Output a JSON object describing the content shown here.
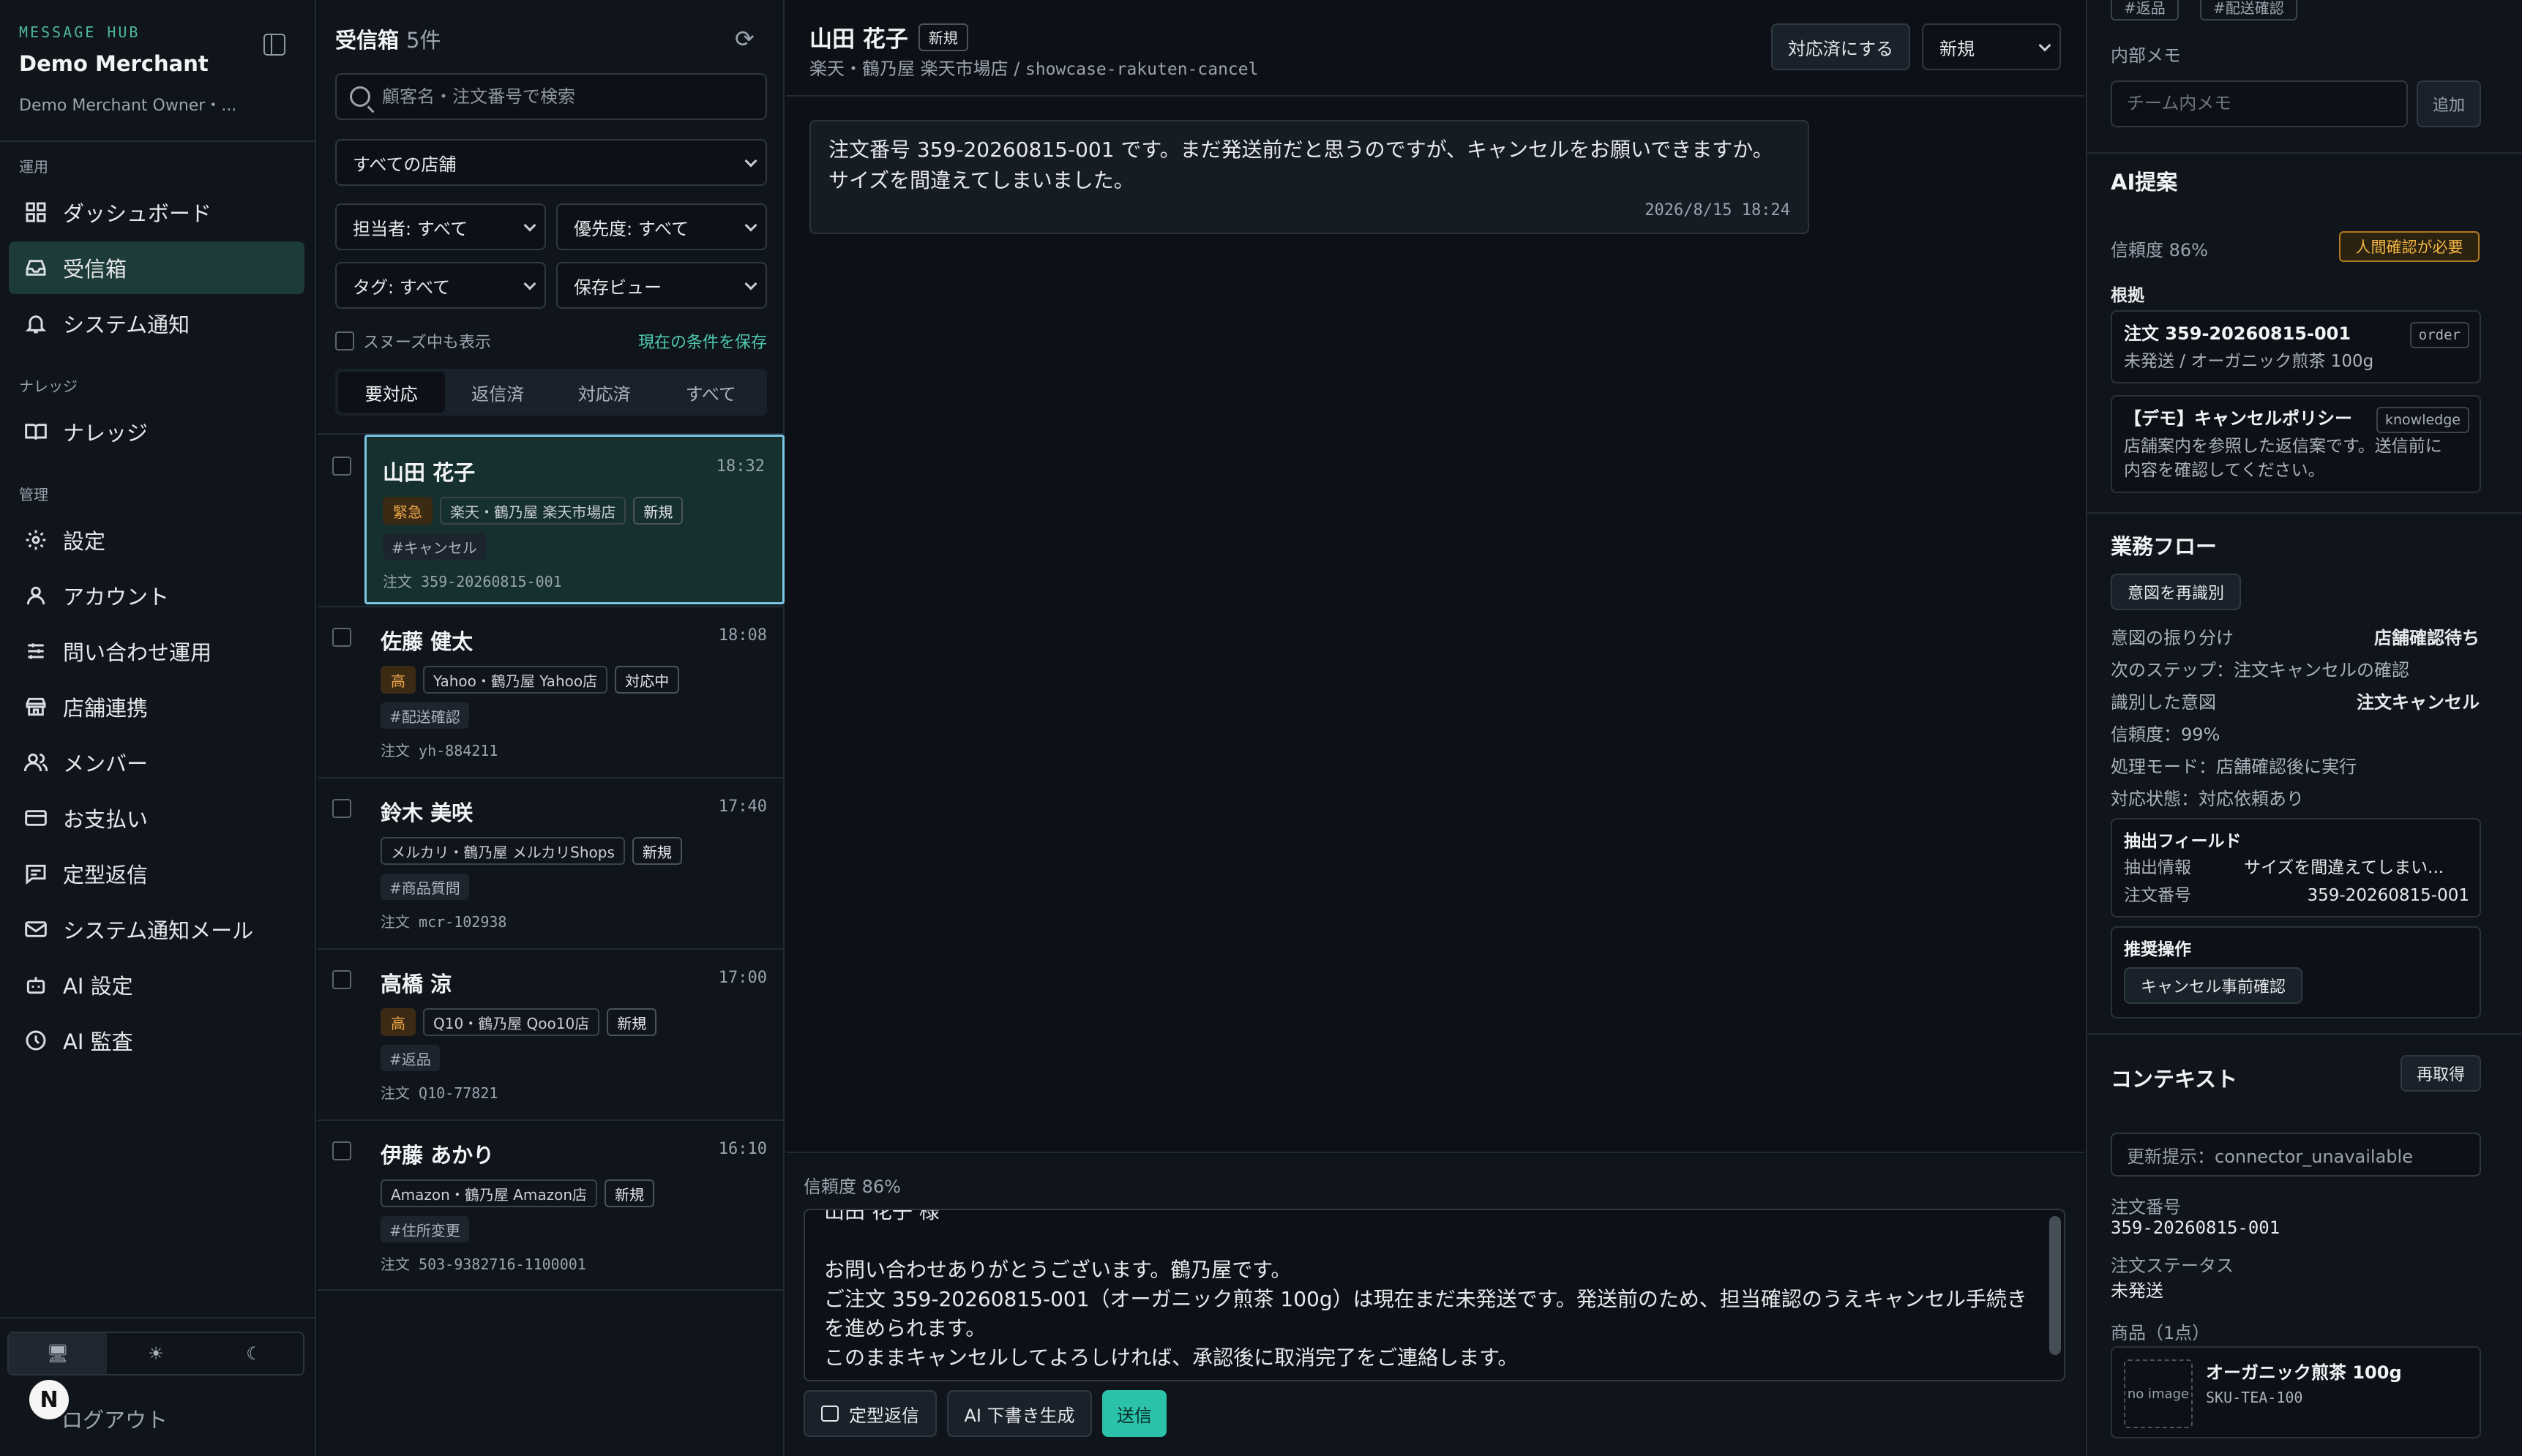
{
  "sidebar": {
    "kicker": "MESSAGE HUB",
    "merchant": "Demo Merchant",
    "owner": "Demo Merchant Owner・...",
    "sections": {
      "ops": "運用",
      "knowledge": "ナレッジ",
      "admin": "管理"
    },
    "items": [
      {
        "label": "ダッシュボード",
        "icon": "dashboard-icon"
      },
      {
        "label": "受信箱",
        "icon": "inbox-icon"
      },
      {
        "label": "システム通知",
        "icon": "bell-icon"
      },
      {
        "label": "ナレッジ",
        "icon": "book-icon"
      },
      {
        "label": "設定",
        "icon": "gear-icon"
      },
      {
        "label": "アカウント",
        "icon": "user-icon"
      },
      {
        "label": "問い合わせ運用",
        "icon": "sliders-icon"
      },
      {
        "label": "店舗連携",
        "icon": "store-icon"
      },
      {
        "label": "メンバー",
        "icon": "users-icon"
      },
      {
        "label": "お支払い",
        "icon": "credit-card-icon"
      },
      {
        "label": "定型返信",
        "icon": "message-icon"
      },
      {
        "label": "システム通知メール",
        "icon": "mail-icon"
      },
      {
        "label": "AI 設定",
        "icon": "bot-icon"
      },
      {
        "label": "AI 監査",
        "icon": "audit-icon"
      }
    ],
    "avatar": "N",
    "logout": "ログアウト"
  },
  "inbox": {
    "title": "受信箱",
    "count": "5件",
    "search_placeholder": "顧客名・注文番号で検索",
    "store_filter": "すべての店舗",
    "assignee_filter": "担当者: すべて",
    "priority_filter": "優先度: すべて",
    "tag_filter": "タグ: すべて",
    "saved_view": "保存ビュー",
    "snooze_label": "スヌーズ中も表示",
    "save_condition": "現在の条件を保存",
    "tabs": [
      "要対応",
      "返信済",
      "対応済",
      "すべて"
    ],
    "conversations": [
      {
        "name": "山田 花子",
        "time": "18:32",
        "priority": "緊急",
        "store": "楽天・鶴乃屋 楽天市場店",
        "status": "新規",
        "tag": "#キャンセル",
        "order": "注文 359-20260815-001"
      },
      {
        "name": "佐藤 健太",
        "time": "18:08",
        "priority": "高",
        "store": "Yahoo・鶴乃屋 Yahoo店",
        "status": "対応中",
        "tag": "#配送確認",
        "order": "注文 yh-884211"
      },
      {
        "name": "鈴木 美咲",
        "time": "17:40",
        "priority": "",
        "store": "メルカリ・鶴乃屋 メルカリShops",
        "status": "新規",
        "tag": "#商品質問",
        "order": "注文 mcr-102938"
      },
      {
        "name": "高橋 涼",
        "time": "17:00",
        "priority": "高",
        "store": "Q10・鶴乃屋 Qoo10店",
        "status": "新規",
        "tag": "#返品",
        "order": "注文 Q10-77821"
      },
      {
        "name": "伊藤 あかり",
        "time": "16:10",
        "priority": "",
        "store": "Amazon・鶴乃屋 Amazon店",
        "status": "新規",
        "tag": "#住所変更",
        "order": "注文 503-9382716-1100001"
      }
    ]
  },
  "conversation": {
    "customer": "山田 花子",
    "status_badge": "新規",
    "store_path": "楽天・鶴乃屋 楽天市場店 / ",
    "slug": "showcase-rakuten-cancel",
    "resolve_button": "対応済にする",
    "status_select": "新規",
    "message": "注文番号 359-20260815-001 です。まだ発送前だと思うのですが、キャンセルをお願いできますか。\nサイズを間違えてしまいました。",
    "message_time": "2026/8/15 18:24",
    "confidence": "信頼度 86%",
    "draft": "山田 花子 様\n\nお問い合わせありがとうございます。鶴乃屋です。\nご注文 359-20260815-001（オーガニック煎茶 100g）は現在まだ未発送です。発送前のため、担当確認のうえキャンセル手続きを進められます。\nこのままキャンセルしてよろしければ、承認後に取消完了をご連絡します。",
    "template_button": "定型返信",
    "ai_draft_button": "AI 下書き生成",
    "send_button": "送信"
  },
  "panel": {
    "tags": [
      "#返品",
      "#配送確認"
    ],
    "memo_label": "内部メモ",
    "memo_placeholder": "チーム内メモ",
    "memo_add": "追加",
    "ai_title": "AI提案",
    "ai_confidence": "信頼度 86%",
    "human_check": "人間確認が必要",
    "evidence_label": "根拠",
    "evidence": [
      {
        "title": "注文 359-20260815-001",
        "kind": "order",
        "body": "未発送 / オーガニック煎茶 100g"
      },
      {
        "title": "【デモ】キャンセルポリシー",
        "kind": "knowledge",
        "body": "店舗案内を参照した返信案です。送信前に\n内容を確認してください。"
      }
    ],
    "flow_title": "業務フロー",
    "reidentify": "意図を再識別",
    "intent_routing_label": "意図の振り分け",
    "intent_routing_value": "店舗確認待ち",
    "next_step": "次のステップ：注文キャンセルの確認",
    "identified_label": "識別した意図",
    "identified_value": "注文キャンセル",
    "flow_confidence": "信頼度：99%",
    "mode": "処理モード：店舗確認後に実行",
    "handling": "対応状態：対応依頼あり",
    "extracted_title": "抽出フィールド",
    "extracted_info_label": "抽出情報",
    "extracted_info_value": "サイズを間違えてしまい...",
    "order_no_label": "注文番号",
    "order_no_value": "359-20260815-001",
    "recommended_title": "推奨操作",
    "recommended_action": "キャンセル事前確認",
    "context_title": "コンテキスト",
    "refetch": "再取得",
    "update_hint": "更新提示：connector_unavailable",
    "ctx_order_label": "注文番号",
    "ctx_order_value": "359-20260815-001",
    "ctx_status_label": "注文ステータス",
    "ctx_status_value": "未発送",
    "items_label": "商品（1点）",
    "product_name": "オーガニック煎茶 100g",
    "product_sku": "SKU-TEA-100",
    "no_image": "no image"
  }
}
